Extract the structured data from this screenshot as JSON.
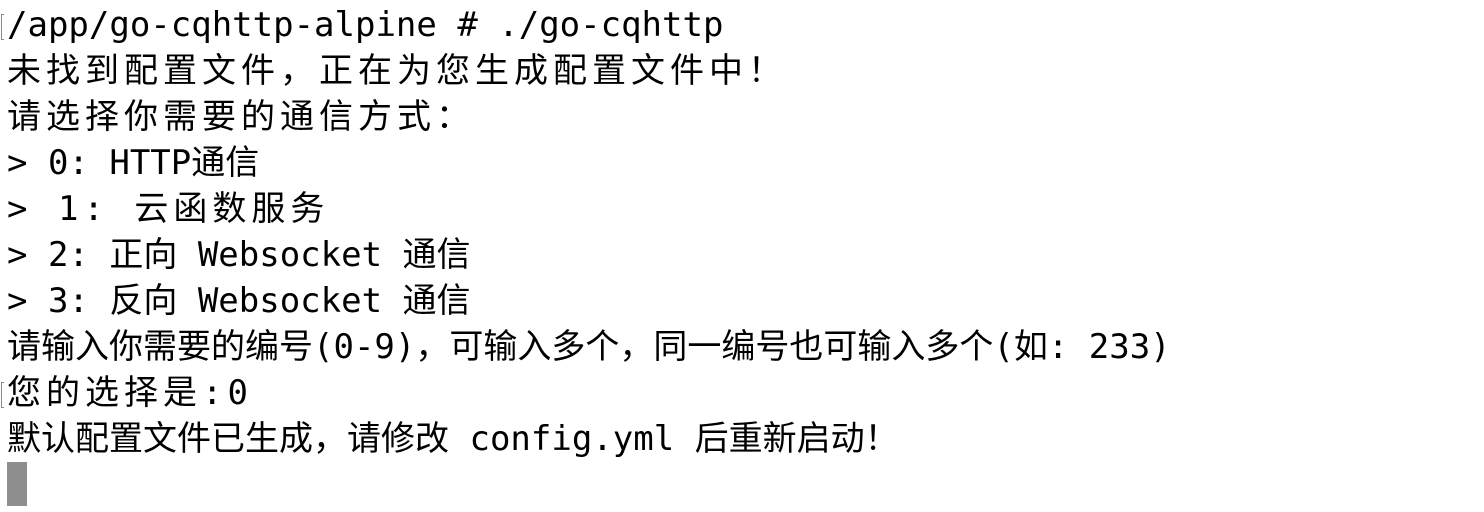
{
  "terminal": {
    "lines": [
      "/app/go-cqhttp-alpine # ./go-cqhttp",
      "未找到配置文件，正在为您生成配置文件中！",
      "请选择你需要的通信方式：",
      "> 0: HTTP通信",
      "> 1: 云函数服务",
      "> 2: 正向 Websocket 通信",
      "> 3: 反向 Websocket 通信",
      "请输入你需要的编号(0-9)，可输入多个，同一编号也可输入多个(如: 233)",
      "您的选择是:0",
      "默认配置文件已生成，请修改 config.yml 后重新启动！"
    ]
  },
  "colors": {
    "background": "#ffffff",
    "text": "#000000",
    "cursor": "#8e8e8e"
  }
}
